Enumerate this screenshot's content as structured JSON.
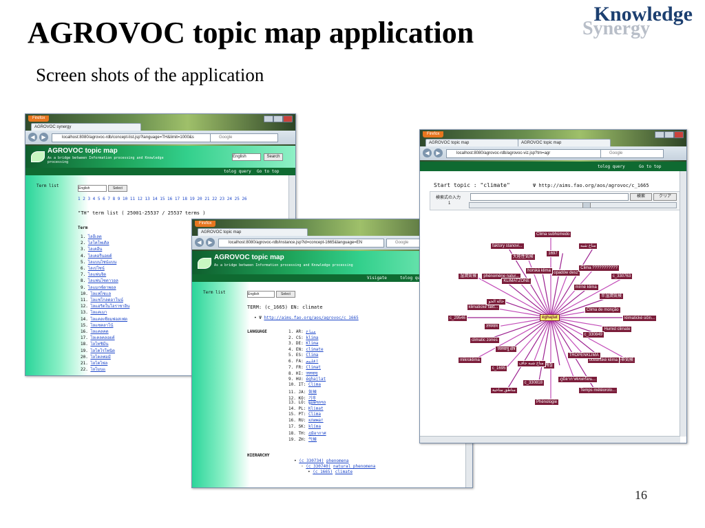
{
  "slide": {
    "title": "AGROVOC topic map application",
    "subtitle": "Screen shots of the application",
    "logo_top": "Knowledge",
    "logo_bottom": "Synergy",
    "page_number": "16"
  },
  "browser": {
    "menu_button": "Firefox",
    "search_placeholder": "Google"
  },
  "app": {
    "title": "AGROVOC topic map",
    "tagline": "As a bridge between Information processing and Knowledge processing"
  },
  "w1": {
    "tab_title": "AGROVOC synergy",
    "url": "localhost:8080/agrovoc-rdb/concept-list.jsp?language=TH&limit=1000&s",
    "header_select": "English",
    "header_search_button": "Search",
    "nav": [
      "tolog query",
      "Go to top"
    ],
    "sidebar_label": "Term list",
    "lang_select": "English",
    "select_button": "Select",
    "pages": "1 2 3 4 5 6 7 8 9 10 11 12 13 14 15 16 17 18 19 20 21 22 23 24 25 26",
    "list_heading": "\"TH\" term list ( 25001-25537 / 25537 terms )",
    "term_label": "Term",
    "terms": [
      "ไลอีเลต",
      "ไลโคโพเดิล",
      "ไลเคอีน",
      "ไลเคอรีนอยด์",
      "ไลแบนไซน์แบน",
      "ไลเปโซน์",
      "ไลแฟนจิด",
      "ไลแฟนไซตาวอล",
      "ไลแมกซ์ดาพอล",
      "ไลแฟไซเเล",
      "ไลแซโกลดอาโนน์",
      "ไลแอริดในโอราชาอิน",
      "ไลแคเมา",
      "ไลแคลเซียมฟอสเฟต",
      "ไลแซคลาโน้",
      "ไลแคลคด",
      "ไลเคลคลอยต์",
      "ไลโทชิมีน",
      "ไลโคโรโพนิด",
      "ไลโคลฟอมี",
      "ไลโคไฟล",
      "ไลโมนแ"
    ]
  },
  "w2": {
    "tab_title": "AGROVOC topic map",
    "url": "localhost:8080/agrovoc-rdb/instance.jsp?id=concept-1665&language=EN",
    "nav": [
      "Visigate",
      "tolog query"
    ],
    "sidebar_label": "Term list",
    "lang_select": "English",
    "select_button": "Select",
    "term_heading": "TERM: (c_1665)  EN: climate",
    "psi": "http://aims.fao.org/aos/agrovoc/c_1665",
    "language_label": "LANGUAGE",
    "languages": [
      {
        "n": "1.",
        "code": "AR:",
        "term": "مناخ"
      },
      {
        "n": "2.",
        "code": "CS:",
        "term": "klima"
      },
      {
        "n": "3.",
        "code": "DE:",
        "term": "Klima"
      },
      {
        "n": "4.",
        "code": "EN:",
        "term": "climate"
      },
      {
        "n": "5.",
        "code": "ES:",
        "term": "Clima"
      },
      {
        "n": "6.",
        "code": "FA:",
        "term": "اقلیم"
      },
      {
        "n": "7.",
        "code": "FR:",
        "term": "Climat"
      },
      {
        "n": "8.",
        "code": "HI:",
        "term": "जलवायु"
      },
      {
        "n": "9.",
        "code": "HU:",
        "term": "éghajlat"
      },
      {
        "n": "10.",
        "code": "IT:",
        "term": "Clima"
      },
      {
        "n": "11.",
        "code": "JA:",
        "term": "気候"
      },
      {
        "n": "12.",
        "code": "KO:",
        "term": "기후"
      },
      {
        "n": "13.",
        "code": "LO:",
        "term": "ພູມອາກາດ"
      },
      {
        "n": "14.",
        "code": "PL:",
        "term": "Klimat"
      },
      {
        "n": "15.",
        "code": "PT:",
        "term": "Clima"
      },
      {
        "n": "16.",
        "code": "RU:",
        "term": "климат"
      },
      {
        "n": "17.",
        "code": "SK:",
        "term": "klíma"
      },
      {
        "n": "18.",
        "code": "TH:",
        "term": "ภูมิอากาศ"
      },
      {
        "n": "19.",
        "code": "ZH:",
        "term": "气候"
      }
    ],
    "hierarchy_label": "HIERARCHY",
    "hierarchy": [
      {
        "code": "(c_330734)",
        "term": "phenomena"
      },
      {
        "code": "(c_330740)",
        "term": "natural phenomena"
      },
      {
        "code": "(c_1665)",
        "term": "climate"
      }
    ]
  },
  "w3": {
    "tabs": [
      "AGROVOC topic map",
      "AGROVOC topic map"
    ],
    "url": "localhost:8080/agrovoc-rdb/agrovoc-viz.jsp?tm=agr",
    "nav": [
      "tolog query",
      "Go to top"
    ],
    "start_label": "Start topic : \"climate\"",
    "psi": "http://aims.fao.org/aos/agrovoc/c_1665",
    "search_label": "検索式の入力",
    "search_button": "検索",
    "clear_button": "クリア",
    "depth": "1",
    "graph": {
      "center": "éghajlat",
      "nodes": [
        "Clima subhúmedo",
        "1697",
        "opadów desz",
        "مناخ شبه",
        "Clima ???????????",
        "mírné klima",
        "c_330763",
        "半湿潤気候",
        "Clima de monção",
        "klimatické účin...",
        "Humid climate",
        "c_330849",
        "亜熱帯気候",
        "océanské klima",
        "TROPENKLIMA",
        "Temps météorolo...",
        "ภูมิอากาศเขตร้อน...",
        "계절",
        "Phénologie",
        "c_330818",
        "مناخ شبه جاف",
        "مناطق مناخية",
        "c_1695",
        "जलवायु क्षेत्र",
        "mikroklima",
        "climatic zones",
        "तापमान",
        "c_29546",
        "klimatické fakt...",
        "حالة الجو",
        "湿潤気候",
        "phénomène natur...",
        "KLIMATZONE",
        "faktory stanovi...",
        "大陸性気候",
        "horská klima"
      ]
    }
  }
}
